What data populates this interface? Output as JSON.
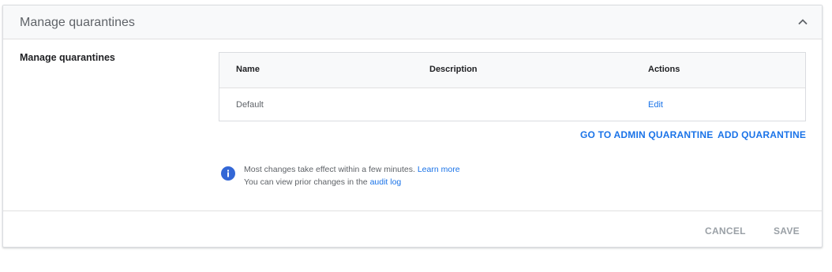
{
  "card": {
    "header_title": "Manage quarantines",
    "collapse_icon": "chevron-up-icon"
  },
  "section": {
    "label": "Manage quarantines"
  },
  "table": {
    "columns": [
      "Name",
      "Description",
      "Actions"
    ],
    "rows": [
      {
        "name": "Default",
        "description": "",
        "action": "Edit"
      }
    ]
  },
  "actions": {
    "go_to_admin_quarantine": "GO TO ADMIN QUARANTINE",
    "add_quarantine": "ADD QUARANTINE"
  },
  "info": {
    "icon": "info-icon",
    "line1_text": "Most changes take effect within a few minutes.",
    "line1_link": "Learn more",
    "line2_text": "You can view prior changes in the",
    "line2_link": "audit log"
  },
  "footer": {
    "cancel": "CANCEL",
    "save": "SAVE"
  },
  "colors": {
    "accent": "#1a73e8",
    "info_icon": "#3367d6",
    "disabled": "#9aa0a6"
  }
}
